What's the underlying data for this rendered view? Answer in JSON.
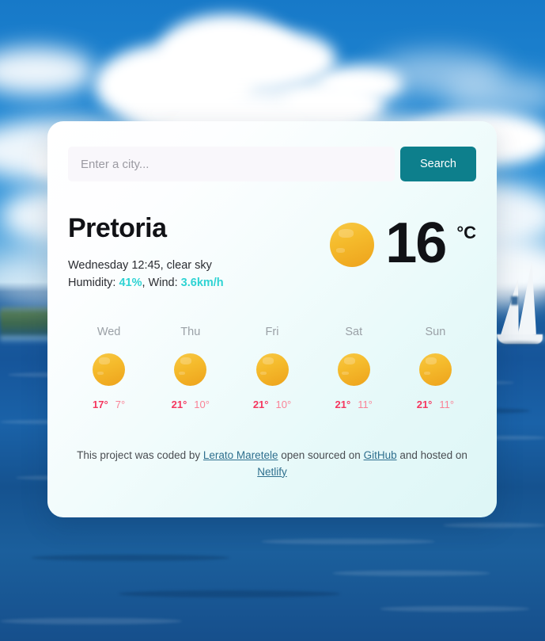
{
  "search": {
    "placeholder": "Enter a city...",
    "value": "",
    "button_label": "Search"
  },
  "current": {
    "city": "Pretoria",
    "date_time_description": "Wednesday 12:45, clear sky",
    "humidity_prefix": "Humidity: ",
    "humidity_value": "41%",
    "wind_prefix": ", Wind: ",
    "wind_value": "3.6km/h",
    "temperature": "16",
    "unit": "°C",
    "icon": "sun-icon"
  },
  "forecast": [
    {
      "day": "Wed",
      "icon": "sun-icon",
      "max": "17°",
      "min": "7°"
    },
    {
      "day": "Thu",
      "icon": "sun-icon",
      "max": "21°",
      "min": "10°"
    },
    {
      "day": "Fri",
      "icon": "sun-icon",
      "max": "21°",
      "min": "10°"
    },
    {
      "day": "Sat",
      "icon": "sun-icon",
      "max": "21°",
      "min": "11°"
    },
    {
      "day": "Sun",
      "icon": "sun-icon",
      "max": "21°",
      "min": "11°"
    }
  ],
  "footer": {
    "text_1": "This project was coded by ",
    "link_author": "Lerato Maretele",
    "text_2": " open sourced on ",
    "link_github": "GitHub",
    "text_3": " and hosted on ",
    "link_netlify": "Netlify"
  },
  "colors": {
    "accent_teal": "#0d7f8c",
    "value_teal": "#2fd3d3",
    "temp_max": "#f5375f",
    "temp_min": "#fa8296",
    "link": "#2e6f8e",
    "sun": "#f5bb2c"
  }
}
